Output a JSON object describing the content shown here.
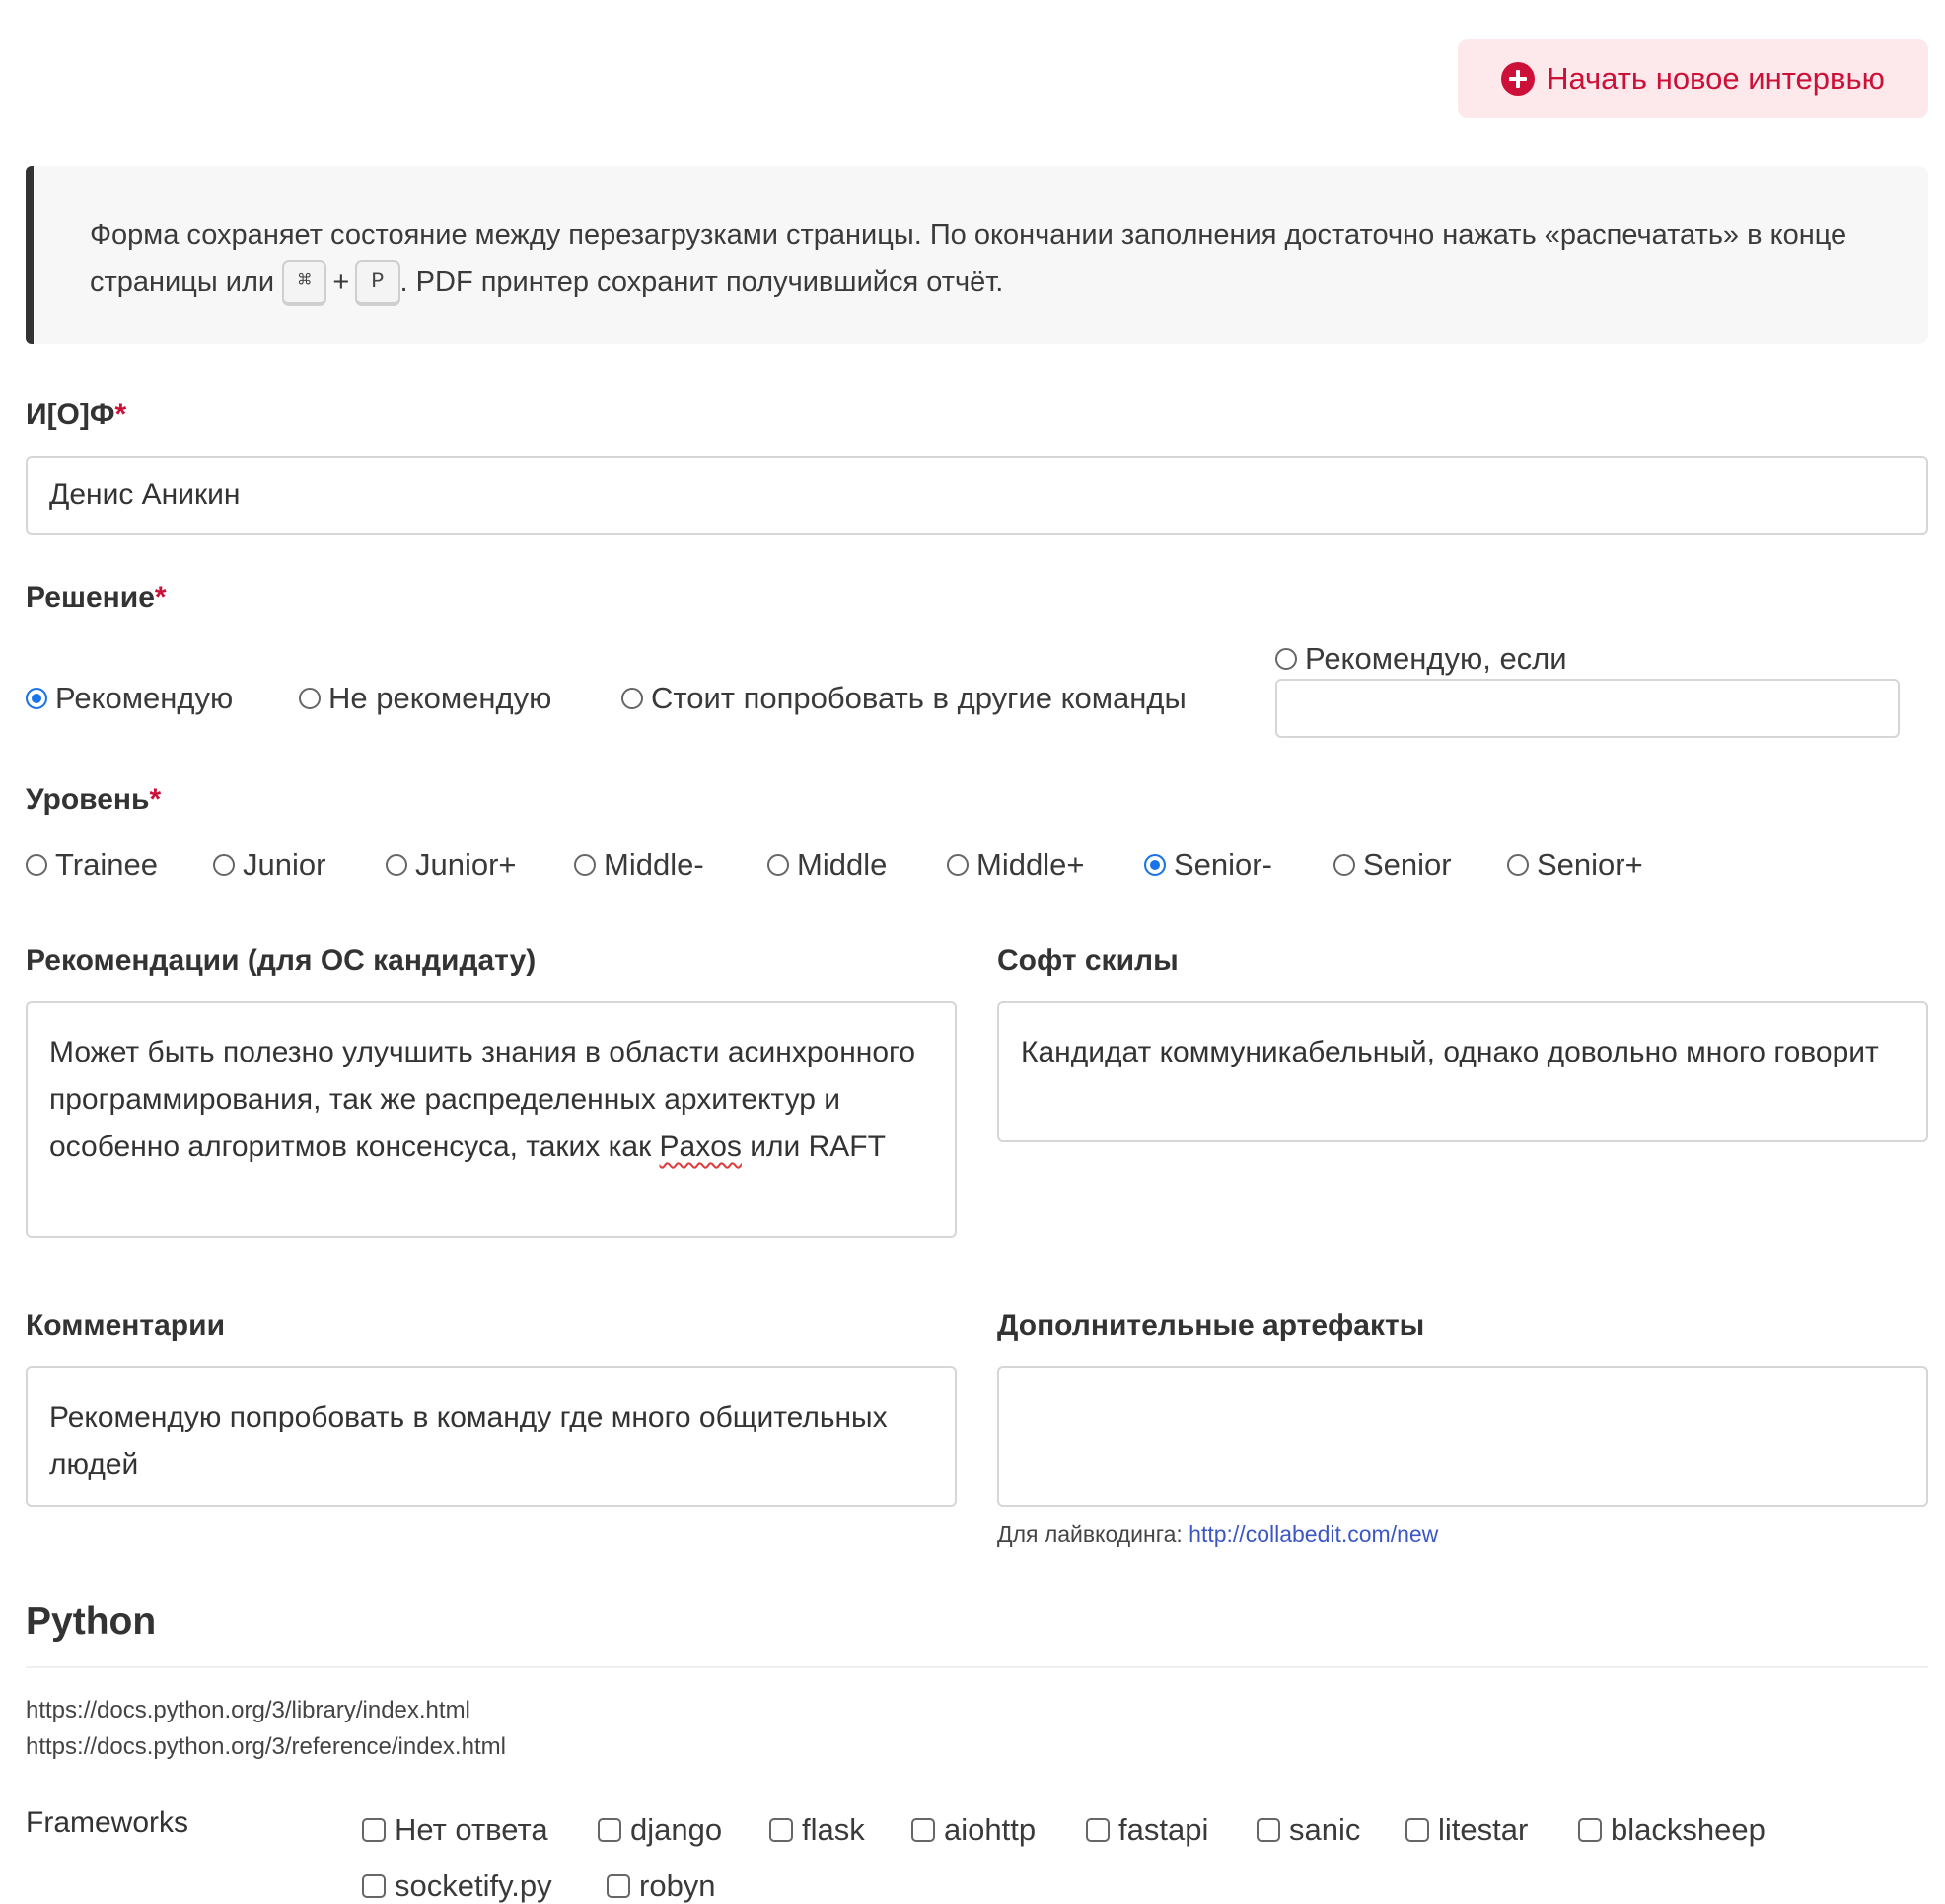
{
  "header": {
    "new_interview_label": "Начать новое интервью",
    "new_interview_icon": "plus-circle-icon"
  },
  "note": {
    "text_before": "Форма сохраняет состояние между перезагрузками страницы. По окончании заполнения достаточно нажать «распечатать» в конце страницы или",
    "key1": "⌘",
    "plus": "+",
    "key2": "P",
    "text_after": ". PDF принтер сохранит получившийся отчёт."
  },
  "name_field": {
    "label": "И[О]Ф",
    "required_mark": "*",
    "value": "Денис Аникин"
  },
  "decision": {
    "label": "Решение",
    "required_mark": "*",
    "options": [
      {
        "label": "Рекомендую",
        "selected": true
      },
      {
        "label": "Не рекомендую",
        "selected": false
      },
      {
        "label": "Стоит попробовать в другие команды",
        "selected": false
      },
      {
        "label": "Рекомендую, если",
        "selected": false
      }
    ],
    "condition_value": ""
  },
  "level": {
    "label": "Уровень",
    "required_mark": "*",
    "options": [
      {
        "label": "Trainee",
        "selected": false
      },
      {
        "label": "Junior",
        "selected": false
      },
      {
        "label": "Junior+",
        "selected": false
      },
      {
        "label": "Middle-",
        "selected": false
      },
      {
        "label": "Middle",
        "selected": false
      },
      {
        "label": "Middle+",
        "selected": false
      },
      {
        "label": "Senior-",
        "selected": true
      },
      {
        "label": "Senior",
        "selected": false
      },
      {
        "label": "Senior+",
        "selected": false
      }
    ]
  },
  "recommendations": {
    "label": "Рекомендации (для ОС кандидату)",
    "text_part1": "Может быть полезно улучшить знания в области асинхронного программирования, так же распределенных архитектур и особенно алгоритмов консенсуса, таких как ",
    "text_misspelled": "Paxos",
    "text_part2": " или RAFT"
  },
  "soft_skills": {
    "label": "Софт скилы",
    "value": "Кандидат коммуникабельный, однако довольно много говорит"
  },
  "comments": {
    "label": "Комментарии",
    "value": "Рекомендую попробовать в команду где много общительных людей"
  },
  "artifacts": {
    "label": "Дополнительные артефакты",
    "value": "",
    "hint_label": "Для лайвкодинга:",
    "hint_link": "http://collabedit.com/new"
  },
  "python_section": {
    "title": "Python",
    "links": [
      "https://docs.python.org/3/library/index.html",
      "https://docs.python.org/3/reference/index.html"
    ],
    "frameworks": {
      "label": "Frameworks",
      "options": [
        {
          "label": "Нет ответа",
          "checked": false
        },
        {
          "label": "django",
          "checked": false
        },
        {
          "label": "flask",
          "checked": false
        },
        {
          "label": "aiohttp",
          "checked": false
        },
        {
          "label": "fastapi",
          "checked": false
        },
        {
          "label": "sanic",
          "checked": false
        },
        {
          "label": "litestar",
          "checked": false
        },
        {
          "label": "blacksheep",
          "checked": false
        },
        {
          "label": "socketify.py",
          "checked": false
        },
        {
          "label": "robyn",
          "checked": false
        }
      ]
    }
  },
  "colors": {
    "accent": "#cc1037",
    "accent_bg": "#fde8ec",
    "radio_selected": "#1a73e8",
    "link": "#3b57c4"
  }
}
